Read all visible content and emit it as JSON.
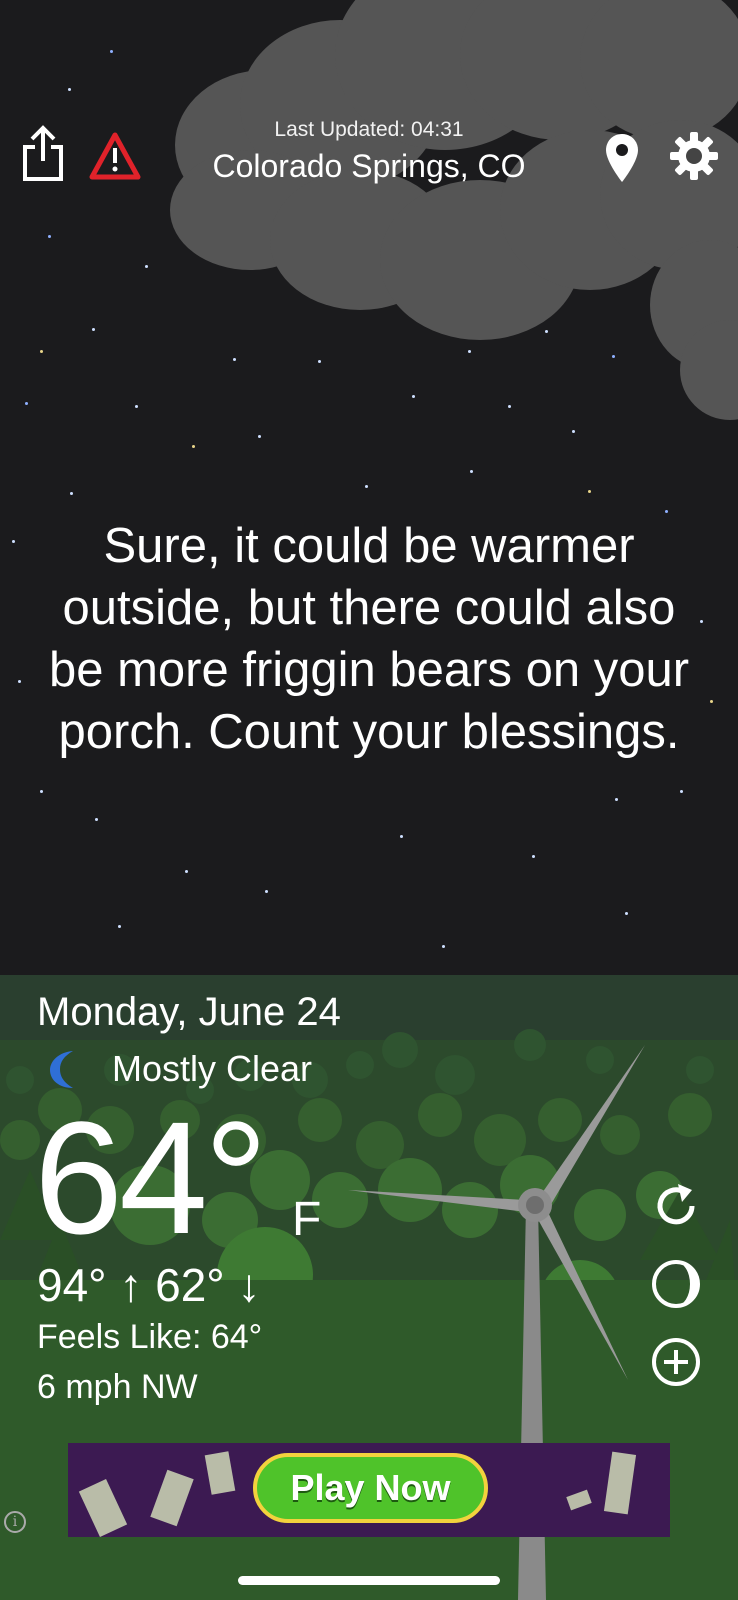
{
  "header": {
    "last_updated": "Last Updated: 04:31",
    "location": "Colorado Springs, CO"
  },
  "icons": {
    "share": "share-icon",
    "alert": "warning-triangle-icon",
    "location": "map-pin-icon",
    "settings": "gear-icon",
    "condition": "crescent-moon-icon",
    "refresh": "refresh-icon",
    "theme": "moon-phase-icon",
    "add": "plus-circle-icon"
  },
  "quote": "Sure, it could be warmer outside, but there could also be more friggin bears on your porch. Count your blessings.",
  "weather": {
    "date": "Monday, June 24",
    "condition": "Mostly Clear",
    "temperature": "64°",
    "unit": "F",
    "hi_lo": "94° ↑  62° ↓",
    "feels_like": "Feels Like: 64°",
    "wind": "6 mph NW"
  },
  "ad": {
    "cta": "Play Now",
    "info": "i"
  },
  "colors": {
    "sky": "#1b1b1d",
    "alert_red": "#e0222a",
    "moon_blue": "#2f6fd6",
    "ad_button_green": "#4fc32a"
  }
}
